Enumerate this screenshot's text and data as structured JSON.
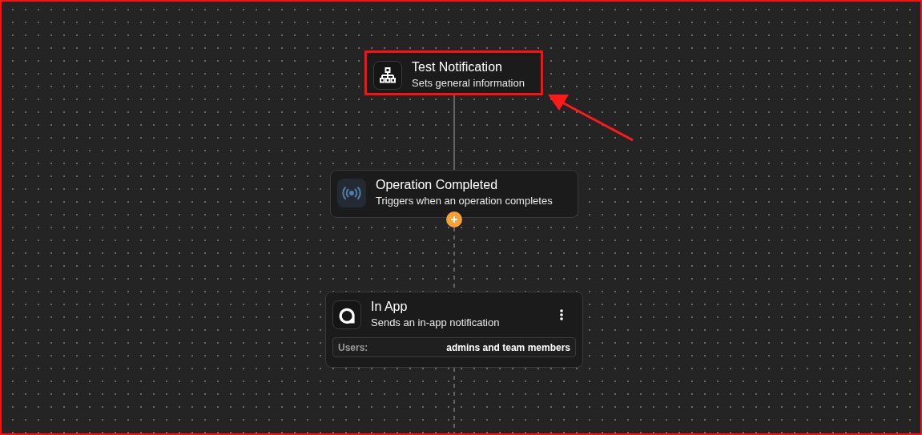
{
  "canvas": {
    "highlighted_frame": true,
    "nodes": [
      {
        "kind": "group",
        "title": "Test Notification",
        "subtitle": "Sets general information",
        "highlighted": true
      },
      {
        "kind": "trigger",
        "title": "Operation Completed",
        "subtitle": "Triggers when an operation completes",
        "highlighted": false
      },
      {
        "kind": "action",
        "title": "In App",
        "subtitle": "Sends an in-app notification",
        "highlighted": false,
        "field": {
          "label": "Users:",
          "value": "admins and team members"
        }
      }
    ]
  }
}
